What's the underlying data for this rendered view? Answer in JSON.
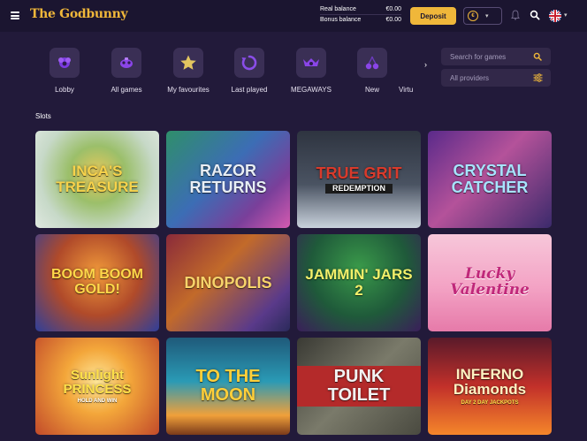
{
  "header": {
    "logo": "The Godbunny",
    "real_balance_label": "Real balance",
    "real_balance_value": "€0.00",
    "bonus_balance_label": "Bonus balance",
    "bonus_balance_value": "€0.00",
    "deposit_label": "Deposit",
    "currency_symbol": "€"
  },
  "categories": [
    {
      "label": "Lobby",
      "icon": "lobby-icon"
    },
    {
      "label": "All games",
      "icon": "all-games-icon"
    },
    {
      "label": "My favourites",
      "icon": "star-icon"
    },
    {
      "label": "Last played",
      "icon": "history-icon"
    },
    {
      "label": "MEGAWAYS",
      "icon": "megaways-icon"
    },
    {
      "label": "New",
      "icon": "cherries-icon"
    },
    {
      "label": "Virtu",
      "icon": "virtual-icon"
    }
  ],
  "search": {
    "placeholder": "Search for games",
    "providers": "All providers"
  },
  "section_title": "Slots",
  "games": [
    {
      "title": "INCA'S TREASURE",
      "subtitle": ""
    },
    {
      "title": "RAZOR RETURNS",
      "subtitle": ""
    },
    {
      "title": "TRUE GRIT",
      "subtitle": "REDEMPTION"
    },
    {
      "title": "CRYSTAL CATCHER",
      "subtitle": ""
    },
    {
      "title": "BOOM BOOM GOLD!",
      "subtitle": ""
    },
    {
      "title": "DINOPOLIS",
      "subtitle": ""
    },
    {
      "title": "JAMMIN' JARS 2",
      "subtitle": ""
    },
    {
      "title": "Lucky Valentine",
      "subtitle": ""
    },
    {
      "title": "Sunlight PRINCESS",
      "subtitle": "HOLD AND WIN"
    },
    {
      "title": "TO THE MOON",
      "subtitle": ""
    },
    {
      "title": "PUNK TOILET",
      "subtitle": ""
    },
    {
      "title": "INFERNO Diamonds",
      "subtitle": "DAY 2 DAY JACKPOTS"
    }
  ],
  "colors": {
    "background": "#221a3a",
    "topbar": "#1b1530",
    "accent": "#f0b73a"
  }
}
